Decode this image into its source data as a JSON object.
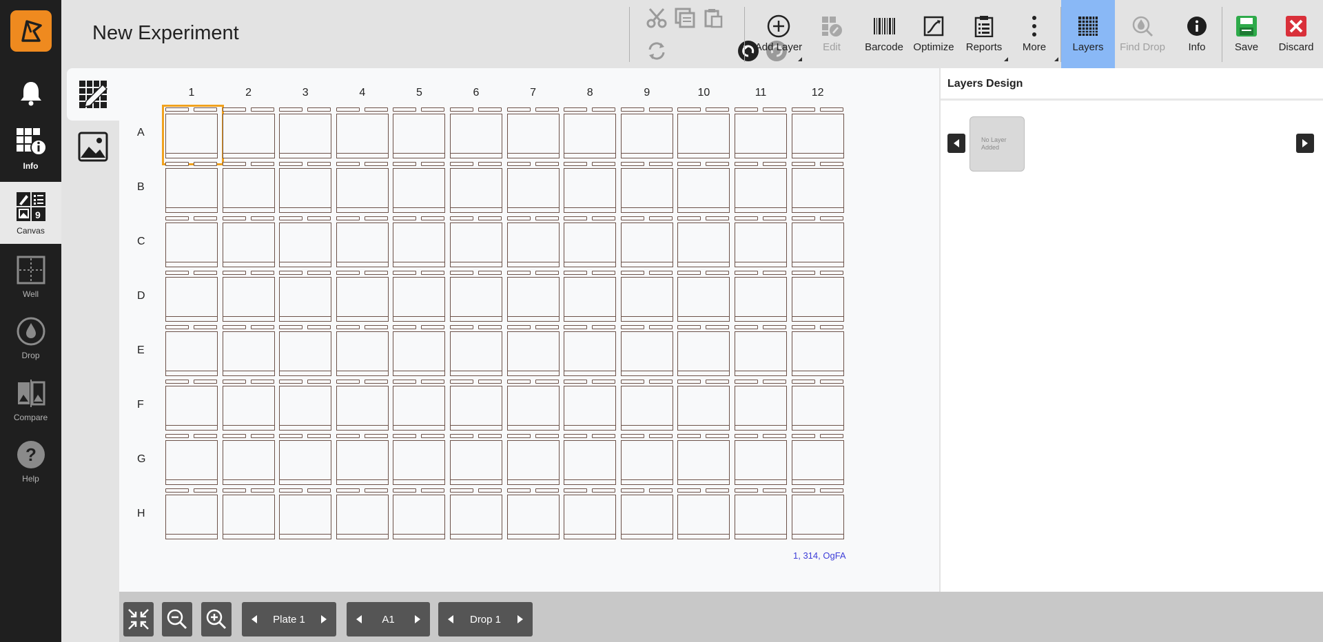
{
  "app": {
    "title": "New Experiment"
  },
  "leftnav": {
    "items": [
      {
        "key": "notifications",
        "icon": "bell-icon",
        "label": ""
      },
      {
        "key": "info",
        "icon": "info-grid-icon",
        "label": "Info"
      },
      {
        "key": "canvas",
        "icon": "canvas-icon",
        "label": "Canvas"
      },
      {
        "key": "well",
        "icon": "well-icon",
        "label": "Well"
      },
      {
        "key": "drop",
        "icon": "drop-icon",
        "label": "Drop"
      },
      {
        "key": "compare",
        "icon": "compare-icon",
        "label": "Compare"
      },
      {
        "key": "help",
        "icon": "help-icon",
        "label": "Help"
      }
    ]
  },
  "toolbar": {
    "add_layer": "Add Layer",
    "edit": "Edit",
    "barcode": "Barcode",
    "optimize": "Optimize",
    "reports": "Reports",
    "more": "More",
    "layers": "Layers",
    "find_drop": "Find Drop",
    "info": "Info",
    "save": "Save",
    "discard": "Discard"
  },
  "plate": {
    "columns": [
      "1",
      "2",
      "3",
      "4",
      "5",
      "6",
      "7",
      "8",
      "9",
      "10",
      "11",
      "12"
    ],
    "rows": [
      "A",
      "B",
      "C",
      "D",
      "E",
      "F",
      "G",
      "H"
    ],
    "selected_well": "A1",
    "coordinate_readout": "1, 314, OgFA"
  },
  "right_panel": {
    "title": "Layers Design",
    "placeholder_line1": "No Layer",
    "placeholder_line2": "Added"
  },
  "bottom_bar": {
    "plate_label": "Plate 1",
    "well_label": "A1",
    "drop_label": "Drop 1"
  },
  "colors": {
    "accent_orange": "#ef8a1f",
    "selection_orange": "#f1a21e",
    "layers_selected": "#89b8f6",
    "save_green": "#2eaa4a",
    "discard_red": "#d9303a",
    "readout_blue": "#3c3cd8"
  }
}
